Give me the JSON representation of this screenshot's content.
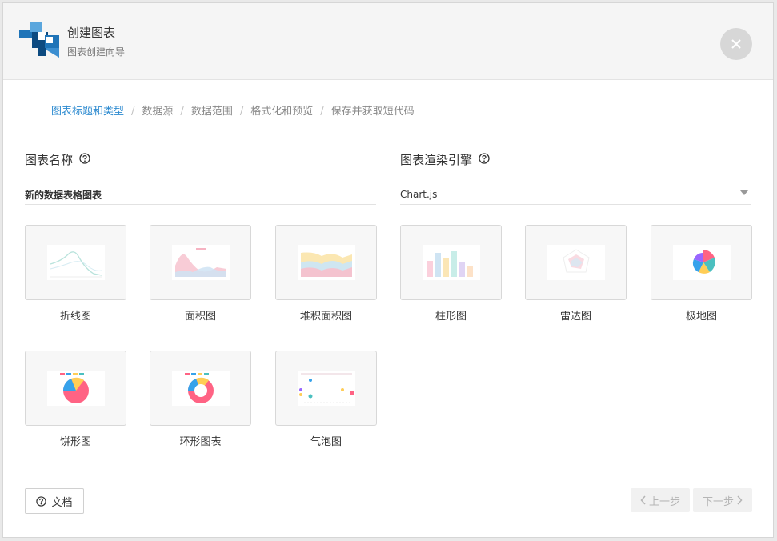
{
  "header": {
    "title": "创建图表",
    "subtitle": "图表创建向导",
    "logo_colors": [
      "#1f74b8",
      "#5aa6dd",
      "#0d4a80"
    ]
  },
  "breadcrumb": {
    "steps": [
      "图表标题和类型",
      "数据源",
      "数据范围",
      "格式化和预览",
      "保存并获取短代码"
    ],
    "active_index": 0,
    "separator": "/"
  },
  "form": {
    "chart_name_label": "图表名称",
    "chart_name_value": "新的数据表格图表",
    "engine_label": "图表渲染引擎",
    "engine_value": "Chart.js"
  },
  "chart_types": [
    {
      "label": "折线图",
      "icon": "line-chart-thumbnail"
    },
    {
      "label": "面积图",
      "icon": "area-chart-thumbnail"
    },
    {
      "label": "堆积面积图",
      "icon": "stacked-area-chart-thumbnail"
    },
    {
      "label": "柱形图",
      "icon": "column-chart-thumbnail"
    },
    {
      "label": "雷达图",
      "icon": "radar-chart-thumbnail"
    },
    {
      "label": "极地图",
      "icon": "polar-chart-thumbnail"
    },
    {
      "label": "饼形图",
      "icon": "pie-chart-thumbnail"
    },
    {
      "label": "环形图表",
      "icon": "doughnut-chart-thumbnail"
    },
    {
      "label": "气泡图",
      "icon": "bubble-chart-thumbnail"
    }
  ],
  "footer": {
    "docs_label": "文档",
    "prev_label": "上一步",
    "next_label": "下一步"
  },
  "colors": {
    "accent": "#2e8bd0",
    "header_bg": "#f5f5f5",
    "close_bg": "#d7d7d7",
    "disabled_text": "#b5b5b5"
  }
}
